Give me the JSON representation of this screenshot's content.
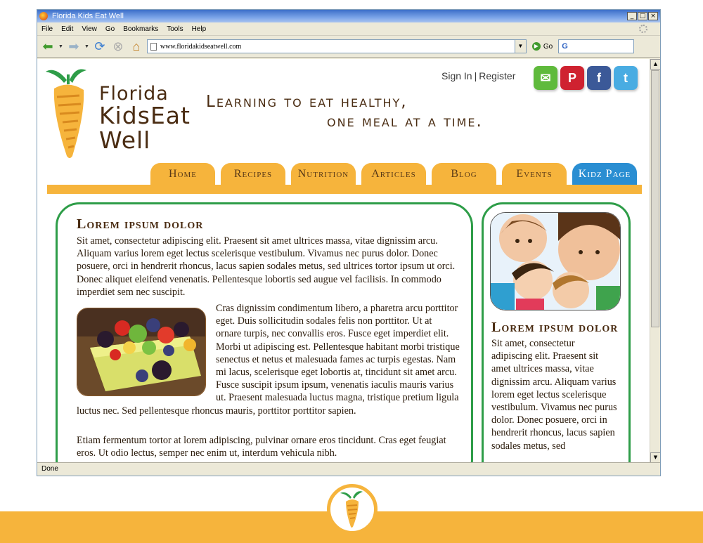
{
  "browser": {
    "title": "Florida Kids Eat Well",
    "menu": [
      "File",
      "Edit",
      "View",
      "Go",
      "Bookmarks",
      "Tools",
      "Help"
    ],
    "url": "www.floridakidseatwell.com",
    "go_label": "Go",
    "search_value": "G",
    "status": "Done"
  },
  "site": {
    "logo": [
      "Florida",
      "KidsEat",
      "Well"
    ],
    "tagline_line1": "Learning to eat healthy,",
    "tagline_line2": "one meal at a time.",
    "sign_in": "Sign In",
    "separator": "|",
    "register": "Register",
    "social": {
      "mail": "✉",
      "pinterest": "P",
      "facebook": "f",
      "twitter": "t"
    },
    "nav": [
      "Home",
      "Recipes",
      "Nutrition",
      "Articles",
      "Blog",
      "Events",
      "Kidz Page"
    ],
    "main": {
      "title": "Lorem ipsum dolor",
      "p1": "Sit amet, consectetur adipiscing elit. Praesent sit amet ultrices massa, vitae dignissim arcu. Aliquam varius lorem eget lectus scelerisque vestibulum. Vivamus nec purus dolor. Donec posuere, orci in hendrerit rhoncus, lacus sapien sodales metus, sed ultrices tortor ipsum ut orci. Donec aliquet eleifend venenatis. Pellentesque lobortis sed augue vel facilisis. In commodo imperdiet sem nec suscipit.",
      "p2": "Cras dignissim condimentum libero, a pharetra arcu porttitor eget. Duis sollicitudin sodales felis non porttitor. Ut at ornare turpis, nec convallis eros. Fusce eget imperdiet elit. Morbi ut adipiscing est. Pellentesque habitant morbi tristique senectus et netus et malesuada fames ac turpis egestas. Nam mi lacus, scelerisque eget lobortis at, tincidunt sit amet arcu. Fusce suscipit ipsum ipsum, venenatis iaculis mauris varius ut. Praesent malesuada luctus magna, tristique pretium ligula luctus nec. Sed pellentesque rhoncus mauris, porttitor porttitor sapien.",
      "p3": "Etiam fermentum tortor at lorem adipiscing, pulvinar ornare eros tincidunt. Cras eget feugiat eros. Ut odio lectus, semper nec enim ut, interdum vehicula nibh."
    },
    "side": {
      "title": "Lorem ipsum dolor",
      "p": "Sit amet, consectetur adipiscing elit. Praesent sit amet ultrices massa, vitae dignissim arcu. Aliquam varius lorem eget lectus scelerisque vestibulum. Vivamus nec purus dolor. Donec posuere, orci in hendrerit rhoncus, lacus sapien sodales metus, sed"
    }
  },
  "colors": {
    "orange": "#f6b43c",
    "green": "#2e9d48",
    "brown": "#4a2c12",
    "blue": "#2a8ed2"
  }
}
